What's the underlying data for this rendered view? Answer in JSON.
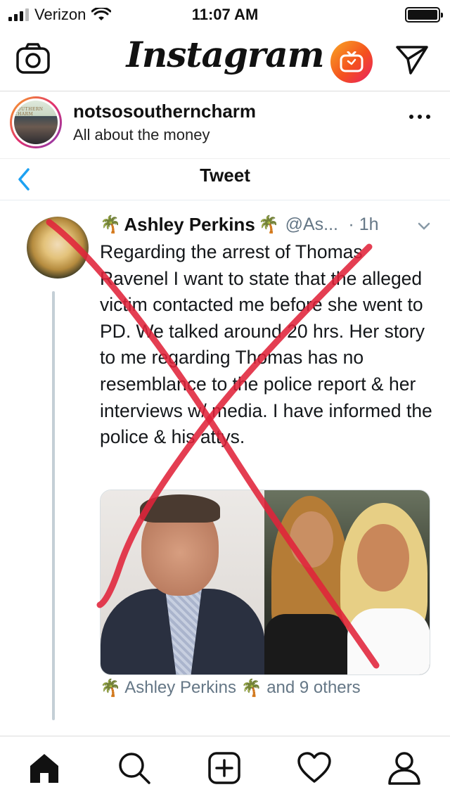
{
  "status_bar": {
    "carrier": "Verizon",
    "time": "11:07 AM"
  },
  "app_header": {
    "logo": "Instagram",
    "icons": [
      "camera-icon",
      "igtv-icon",
      "direct-message-icon"
    ]
  },
  "post": {
    "username": "notsosoutherncharm",
    "caption": "All about the money",
    "avatar_text": "SOUTHERN CHARM"
  },
  "tweet_screen": {
    "nav_title": "Tweet",
    "author_name": "Ashley Perkins",
    "author_emoji": "🌴",
    "handle": "@As...",
    "time": "· 1h",
    "text": "Regarding the arrest of Thomas Ravenel I want to state that the alleged victim contacted me before she went to PD. We talked around 20 hrs. Her story to me regarding Thomas has no resemblance to the police report & her interviews w/ media. I have informed the police & his attys.",
    "liked_by_name": "Ashley Perkins",
    "liked_by_suffix": "and 9 others"
  },
  "overlay": {
    "stroke_color": "#e0233a"
  },
  "bottom_nav": {
    "items": [
      "home-icon",
      "search-icon",
      "new-post-icon",
      "activity-icon",
      "profile-icon"
    ]
  },
  "colors": {
    "ig_text": "#111111",
    "twitter_gray": "#657786",
    "twitter_blue": "#1da1f2",
    "igtv_gradient": [
      "#f9a825",
      "#f4511e",
      "#e91e63"
    ]
  }
}
